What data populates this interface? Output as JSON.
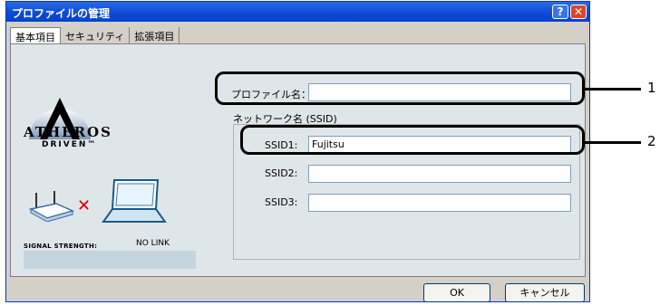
{
  "window": {
    "title": "プロファイルの管理",
    "help_label": "?",
    "close_label": "✕"
  },
  "tabs": [
    {
      "label": "基本項目",
      "active": true
    },
    {
      "label": "セキュリティ",
      "active": false
    },
    {
      "label": "拡張項目",
      "active": false
    }
  ],
  "branding": {
    "logo_line1": "ATHEROS",
    "logo_line2": "DRIVEN™"
  },
  "status": {
    "signal_label": "SIGNAL STRENGTH:",
    "signal_value": "NO LINK"
  },
  "form": {
    "profile_name_label": "プロファイル名：",
    "profile_name_value": "",
    "network_name_label": "ネットワーク名 (SSID)",
    "ssid1_label": "SSID1:",
    "ssid1_value": "Fujitsu",
    "ssid2_label": "SSID2:",
    "ssid2_value": "",
    "ssid3_label": "SSID3:",
    "ssid3_value": ""
  },
  "buttons": {
    "ok": "OK",
    "cancel": "キャンセル"
  },
  "callouts": {
    "one": "1",
    "two": "2"
  },
  "icons": [
    "atheros-logo-icon",
    "router-icon",
    "no-link-x-icon",
    "laptop-icon",
    "help-icon",
    "close-icon"
  ],
  "colors": {
    "titlebar": "#0a49d6",
    "close": "#d9472b",
    "panel": "#dfe6ea",
    "error_x": "#d00000"
  }
}
